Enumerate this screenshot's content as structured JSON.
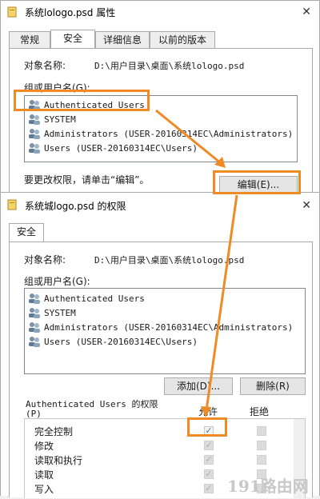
{
  "window1": {
    "title": "系统lologo.psd 属性",
    "tabs": [
      "常规",
      "安全",
      "详细信息",
      "以前的版本"
    ],
    "object_label": "对象名称:",
    "object_path": "D:\\用户目录\\桌面\\系统lologo.psd",
    "group_label": "组或用户名(G):",
    "users": [
      "Authenticated Users",
      "SYSTEM",
      "Administrators (USER-20160314EC\\Administrators)",
      "Users (USER-20160314EC\\Users)"
    ],
    "hint": "要更改权限，请单击“编辑”。",
    "edit_button": "编辑(E)..."
  },
  "window2": {
    "title": "系统城logo.psd 的权限",
    "tab": "安全",
    "object_label": "对象名称:",
    "object_path": "D:\\用户目录\\桌面\\系统lologo.psd",
    "group_label": "组或用户名(G):",
    "users": [
      "Authenticated Users",
      "SYSTEM",
      "Administrators (USER-20160314EC\\Administrators)",
      "Users (USER-20160314EC\\Users)"
    ],
    "add_button": "添加(D)...",
    "remove_button": "删除(R)",
    "perm_title": "Authenticated Users 的权限",
    "perm_title_p": "(P)",
    "allow_header": "允许",
    "deny_header": "拒绝",
    "permissions": [
      "完全控制",
      "修改",
      "读取和执行",
      "读取",
      "写入"
    ]
  },
  "watermark": "191路由网",
  "colors": {
    "highlight": "#f08a24"
  }
}
